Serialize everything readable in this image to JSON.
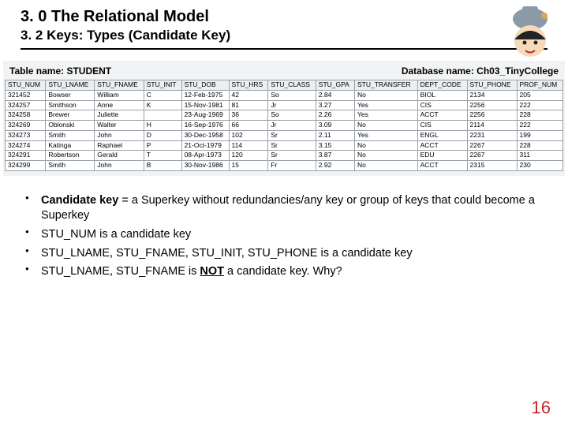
{
  "heading1": "3. 0 The Relational Model",
  "heading2": "3. 2 Keys: Types (Candidate Key)",
  "table_label": "Table name: STUDENT",
  "db_label": "Database name: Ch03_TinyCollege",
  "columns": [
    "STU_NUM",
    "STU_LNAME",
    "STU_FNAME",
    "STU_INIT",
    "STU_DOB",
    "STU_HRS",
    "STU_CLASS",
    "STU_GPA",
    "STU_TRANSFER",
    "DEPT_CODE",
    "STU_PHONE",
    "PROF_NUM"
  ],
  "rows": [
    [
      "321452",
      "Bowser",
      "William",
      "C",
      "12-Feb-1975",
      "42",
      "So",
      "2.84",
      "No",
      "BIOL",
      "2134",
      "205"
    ],
    [
      "324257",
      "Smithson",
      "Anne",
      "K",
      "15-Nov-1981",
      "81",
      "Jr",
      "3.27",
      "Yes",
      "CIS",
      "2256",
      "222"
    ],
    [
      "324258",
      "Brewer",
      "Juliette",
      "",
      "23-Aug-1969",
      "36",
      "So",
      "2.26",
      "Yes",
      "ACCT",
      "2256",
      "228"
    ],
    [
      "324269",
      "Oblonski",
      "Walter",
      "H",
      "16-Sep-1976",
      "66",
      "Jr",
      "3.09",
      "No",
      "CIS",
      "2114",
      "222"
    ],
    [
      "324273",
      "Smith",
      "John",
      "D",
      "30-Dec-1958",
      "102",
      "Sr",
      "2.11",
      "Yes",
      "ENGL",
      "2231",
      "199"
    ],
    [
      "324274",
      "Katinga",
      "Raphael",
      "P",
      "21-Oct-1979",
      "114",
      "Sr",
      "3.15",
      "No",
      "ACCT",
      "2267",
      "228"
    ],
    [
      "324291",
      "Robertson",
      "Gerald",
      "T",
      "08-Apr-1973",
      "120",
      "Sr",
      "3.87",
      "No",
      "EDU",
      "2267",
      "311"
    ],
    [
      "324299",
      "Smith",
      "John",
      "B",
      "30-Nov-1986",
      "15",
      "Fr",
      "2.92",
      "No",
      "ACCT",
      "2315",
      "230"
    ]
  ],
  "bullets": {
    "b1_strong": "Candidate key",
    "b1_rest": " = a Superkey without redundancies/any key or group of keys that could become a Superkey",
    "b2": "STU_NUM is a candidate key",
    "b3": "STU_LNAME, STU_FNAME, STU_INIT, STU_PHONE is a candidate key",
    "b4_pre": "STU_LNAME, STU_FNAME is ",
    "b4_not": "NOT",
    "b4_post": " a candidate key. Why?"
  },
  "page_number": "16"
}
